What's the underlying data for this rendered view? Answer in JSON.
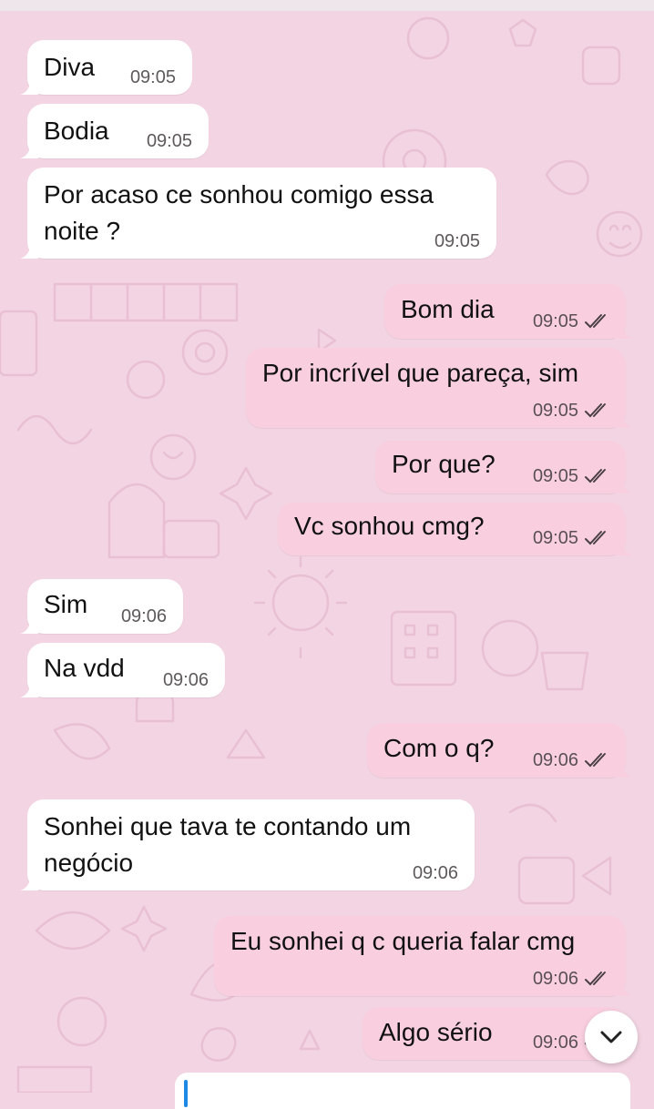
{
  "theme": {
    "incoming_color": "#FFFFFF",
    "outgoing_color": "#F9CFDF",
    "wallpaper_color": "#F3D4E2",
    "read_tick_color": "#4A3F45"
  },
  "messages": [
    {
      "direction": "in",
      "text": "Diva",
      "time": "09:05"
    },
    {
      "direction": "in",
      "text": "Bodia",
      "time": "09:05"
    },
    {
      "direction": "in",
      "line1": "Por acaso ce sonhou comigo essa",
      "line2": "noite ?",
      "time": "09:05"
    },
    {
      "direction": "out",
      "text": "Bom dia",
      "time": "09:05",
      "status": "read"
    },
    {
      "direction": "out",
      "text": "Por incrível que pareça, sim",
      "time": "09:05",
      "status": "read"
    },
    {
      "direction": "out",
      "text": "Por que?",
      "time": "09:05",
      "status": "read"
    },
    {
      "direction": "out",
      "text": "Vc sonhou cmg?",
      "time": "09:05",
      "status": "read"
    },
    {
      "direction": "in",
      "text": "Sim",
      "time": "09:06"
    },
    {
      "direction": "in",
      "text": "Na vdd",
      "time": "09:06"
    },
    {
      "direction": "out",
      "text": "Com o q?",
      "time": "09:06",
      "status": "read"
    },
    {
      "direction": "in",
      "line1": "Sonhei que tava te contando um",
      "line2": "negócio",
      "time": "09:06"
    },
    {
      "direction": "out",
      "text": "Eu sonhei q c queria falar cmg",
      "time": "09:06",
      "status": "read"
    },
    {
      "direction": "out",
      "text": "Algo sério",
      "time": "09:06",
      "status": "read"
    }
  ],
  "scroll_button": {
    "icon": "chevron-down-icon"
  },
  "composer": {
    "value": ""
  }
}
